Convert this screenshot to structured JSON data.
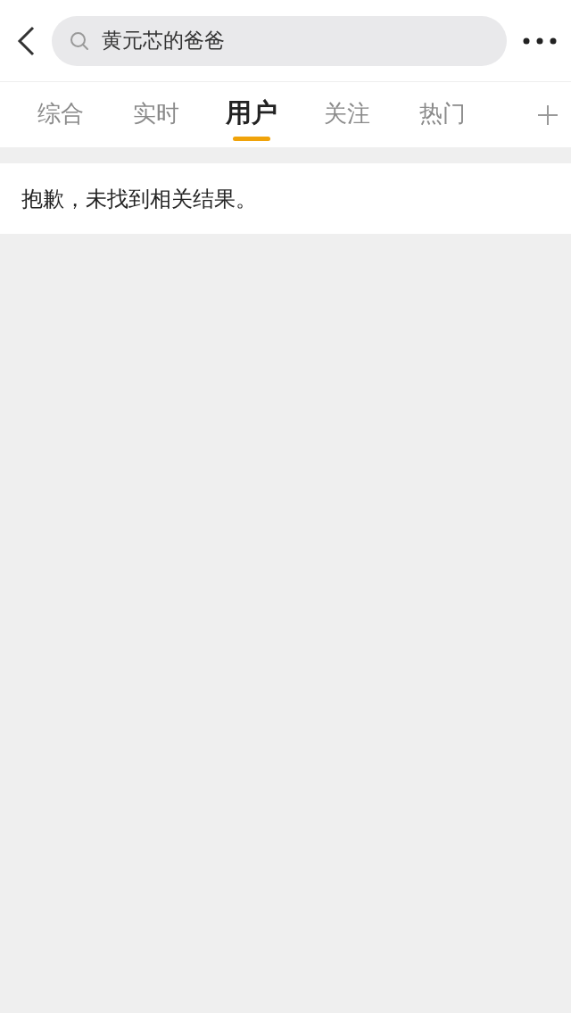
{
  "search": {
    "value": "黄元芯的爸爸"
  },
  "tabs": [
    {
      "label": "综合",
      "selected": false
    },
    {
      "label": "实时",
      "selected": false
    },
    {
      "label": "用户",
      "selected": true
    },
    {
      "label": "关注",
      "selected": false
    },
    {
      "label": "热门",
      "selected": false
    }
  ],
  "message": "抱歉，未找到相关结果。"
}
